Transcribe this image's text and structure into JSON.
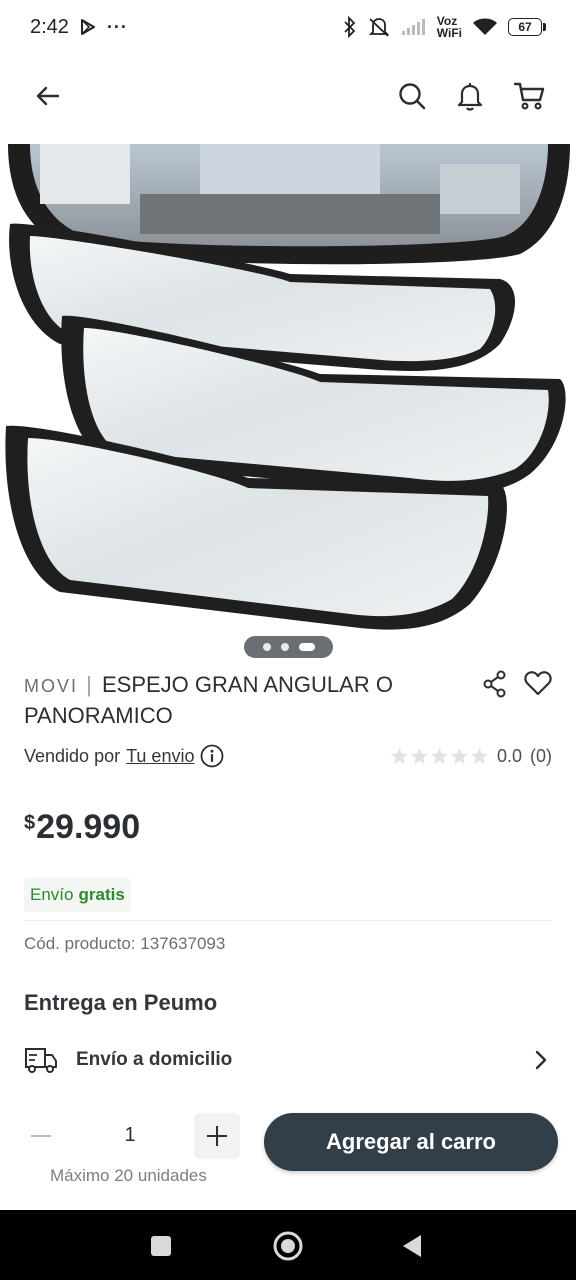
{
  "status_bar": {
    "time": "2:42",
    "voz": "Voz",
    "wifi": "WiFi",
    "battery": "67"
  },
  "header": {
    "back_icon": "arrow-left-icon",
    "search_icon": "search-icon",
    "notifications_icon": "bell-icon",
    "cart_icon": "cart-icon"
  },
  "product": {
    "brand": "MOVI",
    "separator": "|",
    "name": "ESPEJO GRAN ANGULAR O PANORAMICO",
    "seller_prefix": "Vendido por",
    "seller_name": "Tu envio",
    "rating_value": "0.0",
    "rating_count": "(0)",
    "stars_filled": 0,
    "stars_total": 5,
    "currency": "$",
    "price": "29.990",
    "shipping_label": "Envío",
    "shipping_value": "gratis",
    "sku": "Cód. producto: 137637093",
    "carousel_total": 3,
    "carousel_active": 3
  },
  "delivery": {
    "title": "Entrega en Peumo",
    "option_label": "Envío a domicilio"
  },
  "purchase": {
    "quantity": "1",
    "max_label": "Máximo 20 unidades",
    "add_to_cart": "Agregar al carro"
  },
  "colors": {
    "primary_button": "#333f48",
    "shipping_green": "#2d8a2b",
    "nav_bar": "#000000"
  }
}
